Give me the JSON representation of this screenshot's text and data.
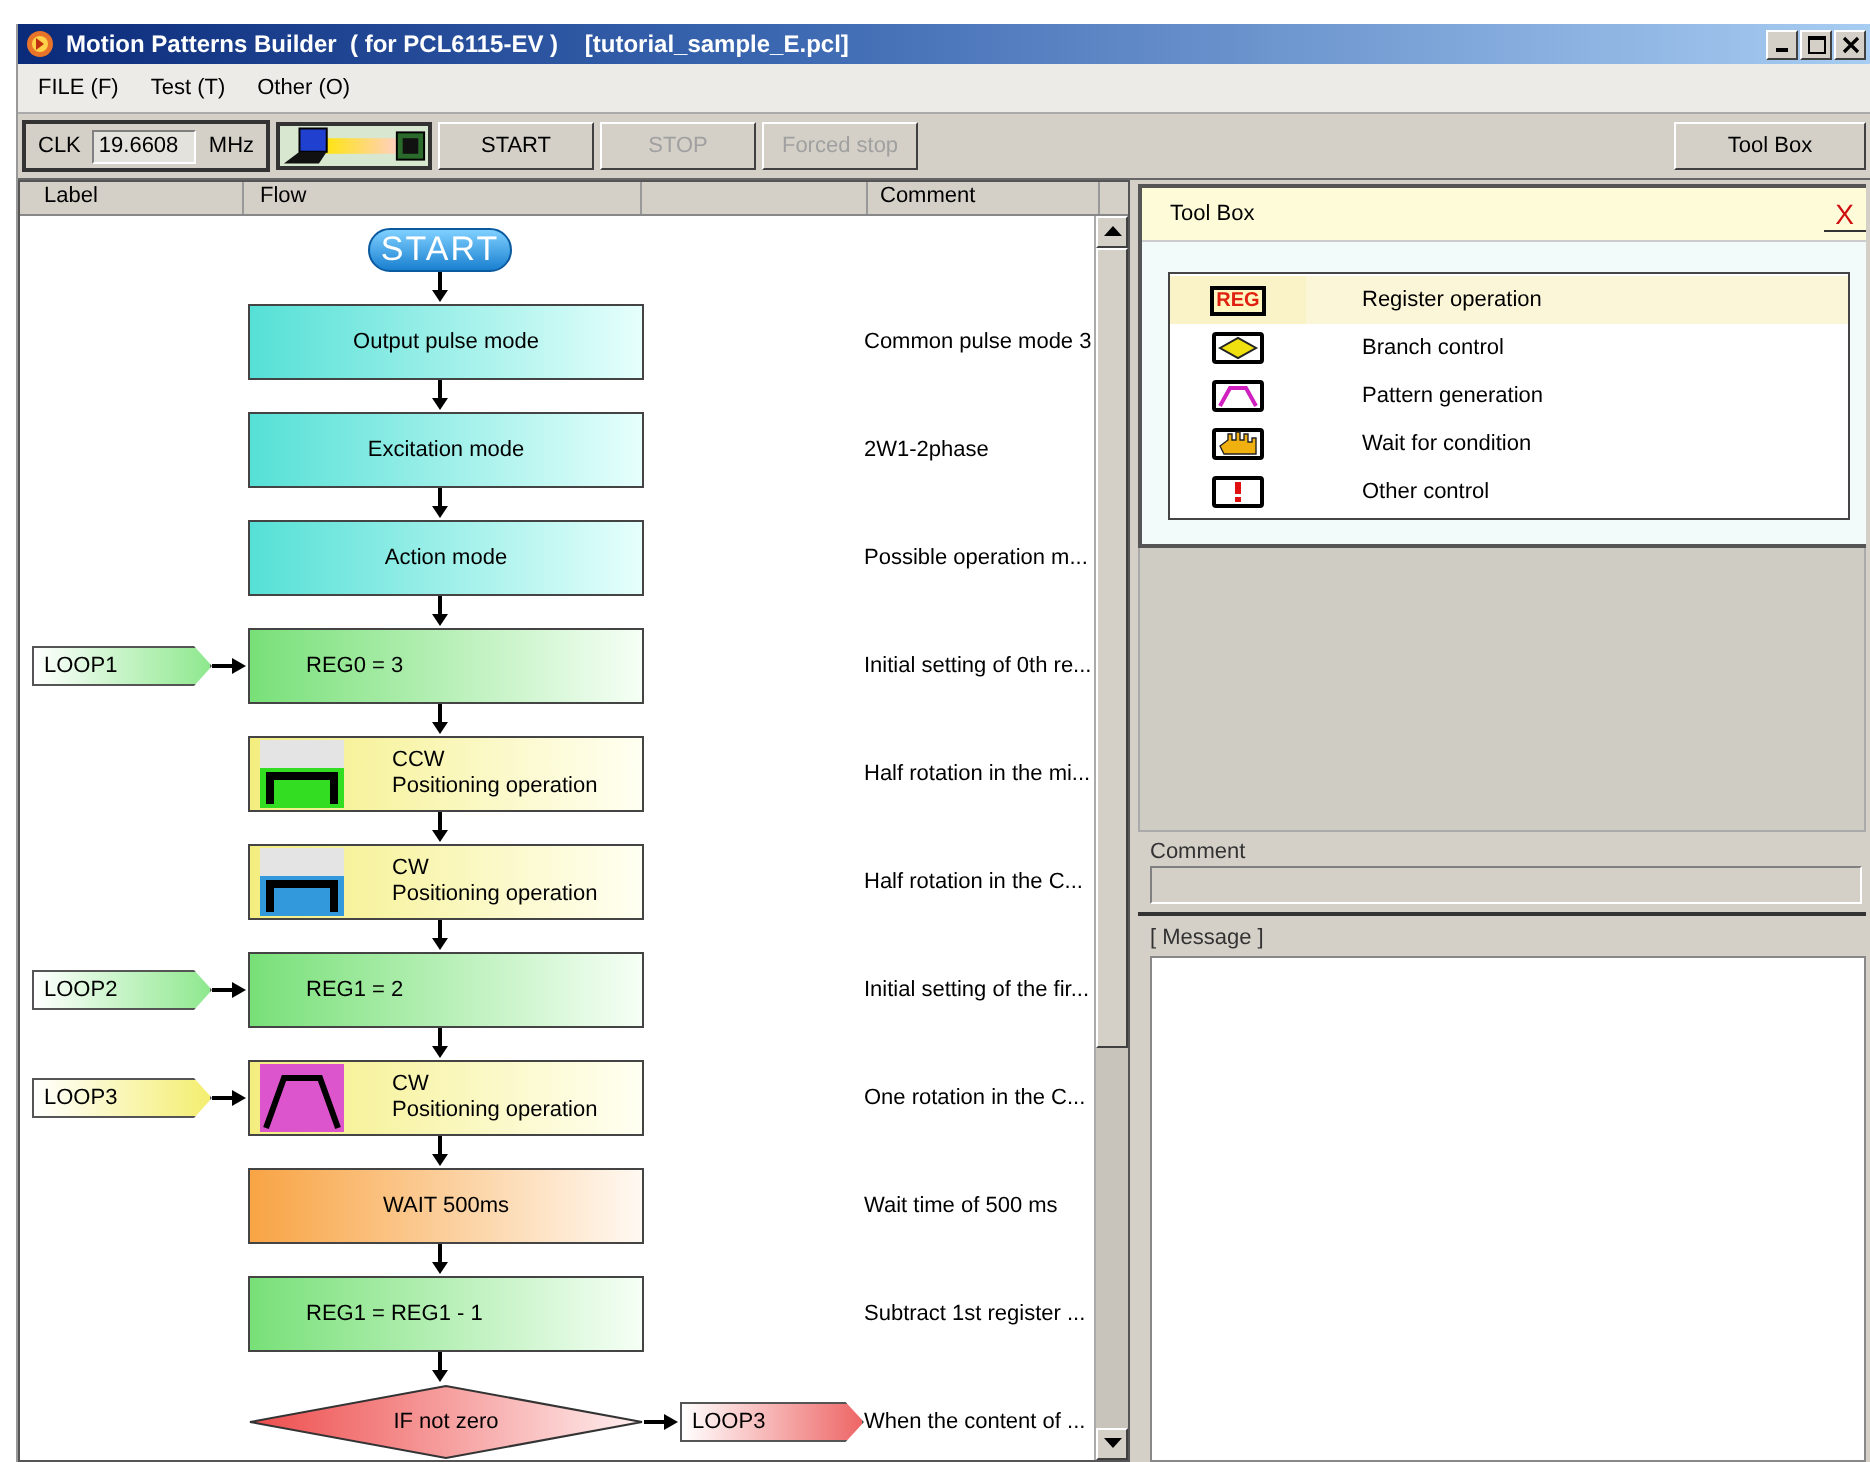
{
  "window": {
    "title": "Motion Patterns Builder  ( for PCL6115-EV )    [tutorial_sample_E.pcl]"
  },
  "menu": [
    "FILE (F)",
    "Test (T)",
    "Other (O)"
  ],
  "toolbar": {
    "clk_label": "CLK",
    "clk_value": "19.6608",
    "clk_unit": "MHz",
    "buttons": [
      {
        "label": "START",
        "disabled": false
      },
      {
        "label": "STOP",
        "disabled": true
      },
      {
        "label": "Forced stop",
        "disabled": true
      }
    ],
    "toolbox_button": "Tool Box"
  },
  "flow": {
    "columns": [
      "Label",
      "Flow",
      "Comment"
    ],
    "steps": [
      {
        "kind": "start",
        "text": "START"
      },
      {
        "kind": "mode",
        "lines": [
          "Output pulse mode"
        ],
        "comment": "Common pulse mode 3"
      },
      {
        "kind": "mode",
        "lines": [
          "Excitation mode"
        ],
        "comment": "2W1-2phase"
      },
      {
        "kind": "mode",
        "lines": [
          "Action mode"
        ],
        "comment": "Possible operation m..."
      },
      {
        "kind": "register",
        "label": "LOOP1",
        "lines": [
          "REG0 = 3"
        ],
        "comment": "Initial setting of 0th re..."
      },
      {
        "kind": "position",
        "color": "#33dd22",
        "lines": [
          "CCW",
          "Positioning operation"
        ],
        "comment": "Half rotation in the mi..."
      },
      {
        "kind": "position",
        "color": "#3399dd",
        "lines": [
          "CW",
          "Positioning operation"
        ],
        "comment": "Half rotation in the C..."
      },
      {
        "kind": "register",
        "label": "LOOP2",
        "lines": [
          "REG1 = 2"
        ],
        "comment": "Initial setting of the fir..."
      },
      {
        "kind": "pattern",
        "color": "#dd55cc",
        "label": "LOOP3",
        "lines": [
          "CW",
          "Positioning operation"
        ],
        "comment": "One rotation in the C..."
      },
      {
        "kind": "wait",
        "lines": [
          "WAIT 500ms"
        ],
        "comment": "Wait time of 500 ms"
      },
      {
        "kind": "register",
        "lines": [
          "REG1 = REG1 - 1"
        ],
        "comment": "Subtract 1st register ..."
      },
      {
        "kind": "decision",
        "lines": [
          "IF not zero"
        ],
        "jump": "LOOP3",
        "comment": "When the content of ..."
      }
    ]
  },
  "toolbox": {
    "title": "Tool Box",
    "close": "X",
    "items": [
      {
        "kind": "register",
        "badge": "REG",
        "label": "Register operation",
        "selected": true
      },
      {
        "kind": "branch",
        "label": "Branch control",
        "selected": false
      },
      {
        "kind": "pattern",
        "label": "Pattern generation",
        "selected": false
      },
      {
        "kind": "wait",
        "label": "Wait for condition",
        "selected": false
      },
      {
        "kind": "other",
        "label": "Other control",
        "selected": false
      }
    ]
  },
  "comment": {
    "label": "Comment"
  },
  "message": {
    "label": "[ Message ]"
  }
}
